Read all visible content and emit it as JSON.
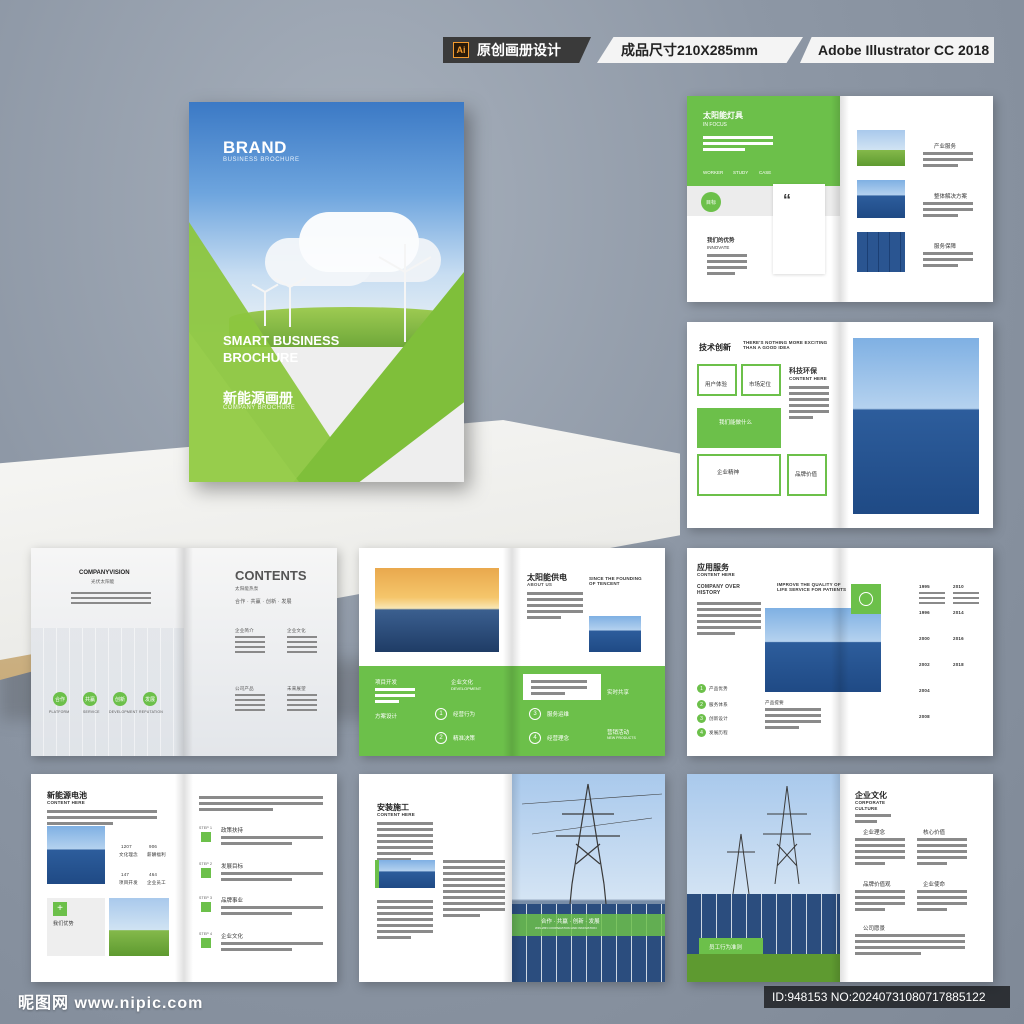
{
  "header": {
    "ai_badge": "Ai",
    "design_label": "原创画册设计",
    "size_label": "成品尺寸210X285mm",
    "software_label": "Adobe Illustrator CC 2018"
  },
  "cover": {
    "brand": "BRAND",
    "brand_sub": "BUSINESS BROCHURE",
    "smart": "SMART BUSINESS BROCHURE",
    "title_cn": "新能源画册",
    "company": "COMPANY BROCHURE"
  },
  "spread1": {
    "title": "太阳能灯具",
    "subtitle": "IN FOCUS",
    "tabs": [
      "WORKER",
      "STUDY",
      "CASE"
    ],
    "goal": "目标",
    "adv_title": "我们的优势",
    "adv_sub": "INNOVATE",
    "items": [
      "产业服务",
      "整体解决方案",
      "服务保障"
    ]
  },
  "spread2": {
    "title": "技术创新",
    "tagline": "THERE'S NOTHING MORE EXCITING THAN A GOOD IDEA",
    "right_title": "科技环保",
    "right_sub": "CONTENT HERE",
    "boxes": [
      "用户体验",
      "市场定位",
      "我们能做什么",
      "企业精神",
      "品牌价值"
    ]
  },
  "spread3": {
    "company_vision": "COMPANYVISION",
    "vision_cn": "光伏太阳能",
    "circles": [
      "合作",
      "共赢",
      "创新",
      "发展"
    ],
    "circle_subs": [
      "PLATFORM",
      "SERVICE",
      "DEVELOPMENT",
      "REPUTATION"
    ],
    "contents": "CONTENTS",
    "contents_cn": "太阳能热泵",
    "contents_tag": "合作 · 共赢 · 创新 · 发展",
    "sections": [
      "企业简介",
      "企业文化",
      "公司产品",
      "未来展望"
    ]
  },
  "spread4": {
    "title": "太阳能供电",
    "about": "ABOUT US",
    "since": "SINCE THE FOUNDING OF TENCENT",
    "left_labels": [
      "项目开发",
      "方案设计"
    ],
    "culture": "企业文化",
    "culture_sub": "DEVELOPMENT",
    "steps": [
      "经营行为",
      "精准决策",
      "服务运维",
      "经营理念"
    ],
    "right_labels": [
      "实时共享",
      "营销活动"
    ],
    "right_subs": [
      "NEW PRODUCTS"
    ]
  },
  "spread5": {
    "title": "应用服务",
    "content": "CONTENT HERE",
    "overview": "COMPANY OVER HISTORY",
    "improve": "IMPROVE THE QUALITY OF LIFE SERVICE FOR PATIENTS",
    "list": [
      "产品优势",
      "服务体系",
      "创新设计",
      "发展历程"
    ],
    "mid_label": "产品提要",
    "years_left": [
      "1995",
      "1996",
      "2000",
      "2002",
      "2004",
      "2008"
    ],
    "years_right": [
      "2010",
      "2014",
      "2016",
      "2018"
    ]
  },
  "spread6": {
    "title": "新能源电池",
    "content": "CONTENT HERE",
    "stats": [
      {
        "num": "1207",
        "label": "文化理念"
      },
      {
        "num": "906",
        "label": "薪酬福利"
      },
      {
        "num": "147",
        "label": "项目开发"
      },
      {
        "num": "464",
        "label": "企业员工"
      }
    ],
    "adv": "我们优势",
    "steps": [
      "政策扶持",
      "发展目标",
      "品牌事业",
      "企业文化"
    ],
    "step_labels": [
      "STEP 1",
      "STEP 2",
      "STEP 3",
      "STEP 4"
    ]
  },
  "spread7": {
    "title": "安装施工",
    "content": "CONTENT HERE",
    "banner": "合作 · 共赢 · 创新 · 发展",
    "banner_sub": "WIN-WIN COOPERATION AND INNOVATION"
  },
  "spread8": {
    "title": "企业文化",
    "sub1": "CORPORATE",
    "sub2": "CULTURE",
    "items": [
      "企业理念",
      "核心价值",
      "品牌价值观",
      "企业使命",
      "公司愿景"
    ],
    "badge": "员工行为准则"
  },
  "footer": {
    "logo": "昵图网 www.nipic.com",
    "id": "ID:948153 NO:20240731080717885122"
  }
}
